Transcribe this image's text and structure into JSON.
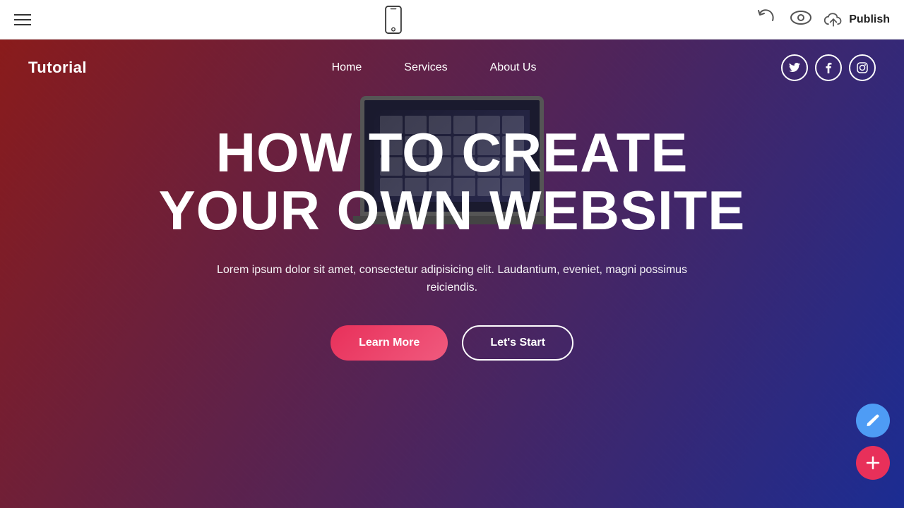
{
  "toolbar": {
    "publish_label": "Publish"
  },
  "site": {
    "logo": "Tutorial",
    "nav": {
      "links": [
        {
          "label": "Home"
        },
        {
          "label": "Services"
        },
        {
          "label": "About Us"
        }
      ]
    },
    "social": {
      "twitter": "T",
      "facebook": "f",
      "instagram": "in"
    },
    "hero": {
      "title_line1": "HOW TO CREATE",
      "title_line2": "YOUR OWN WEBSITE",
      "subtitle": "Lorem ipsum dolor sit amet, consectetur adipisicing elit. Laudantium, eveniet, magni possimus reiciendis.",
      "btn_learn_more": "Learn More",
      "btn_lets_start": "Let's Start"
    }
  }
}
